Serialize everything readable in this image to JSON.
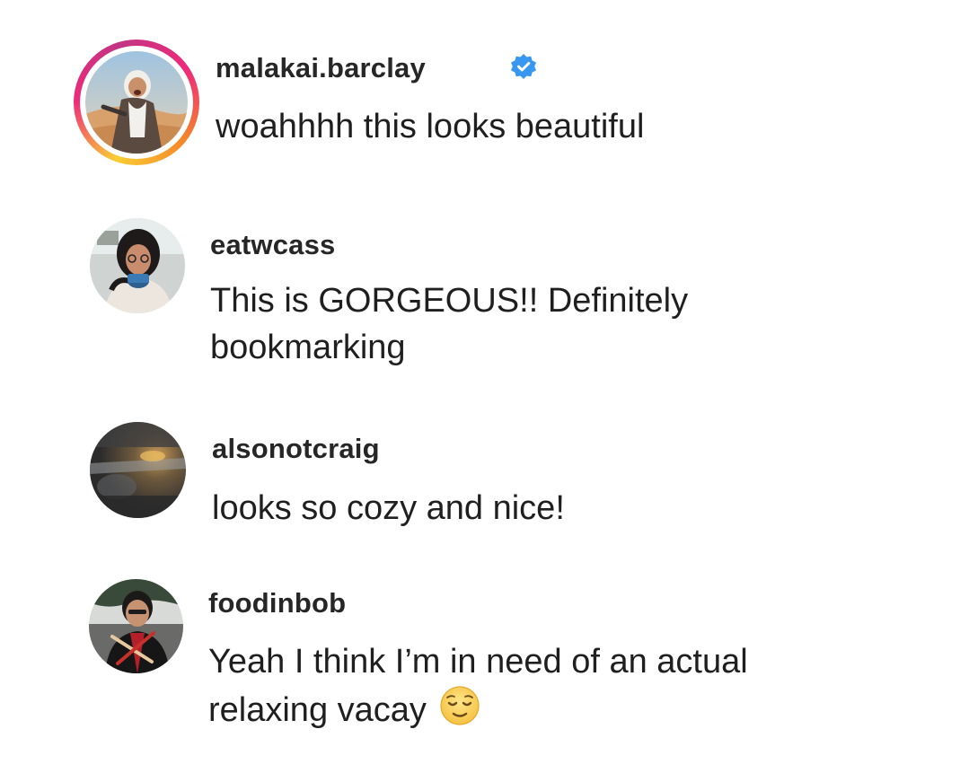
{
  "accent_colors": {
    "verified_badge": "#3897f0",
    "story_ring": [
      "#f9ce34",
      "#ee2a7b",
      "#c13584",
      "#f58529"
    ]
  },
  "comments": [
    {
      "username": "malakai.barclay",
      "verified": true,
      "has_story_ring": true,
      "text_lines": [
        "woahhhh this looks beautiful"
      ],
      "avatar_icon": "profile-photo-desert"
    },
    {
      "username": "eatwcass",
      "verified": false,
      "has_story_ring": false,
      "text_lines": [
        "This is GORGEOUS!! Definitely",
        "bookmarking"
      ],
      "avatar_icon": "profile-photo-woman-mug"
    },
    {
      "username": "alsonotcraig",
      "verified": false,
      "has_story_ring": false,
      "text_lines": [
        "looks so cozy and nice!"
      ],
      "avatar_icon": "profile-photo-blurry-lights"
    },
    {
      "username": "foodinbob",
      "verified": false,
      "has_story_ring": false,
      "text_lines": [
        "Yeah I think I’m in need of an actual",
        "relaxing vacay"
      ],
      "emoji": "relieved-face-emoji",
      "avatar_icon": "profile-photo-man-chopsticks"
    }
  ]
}
